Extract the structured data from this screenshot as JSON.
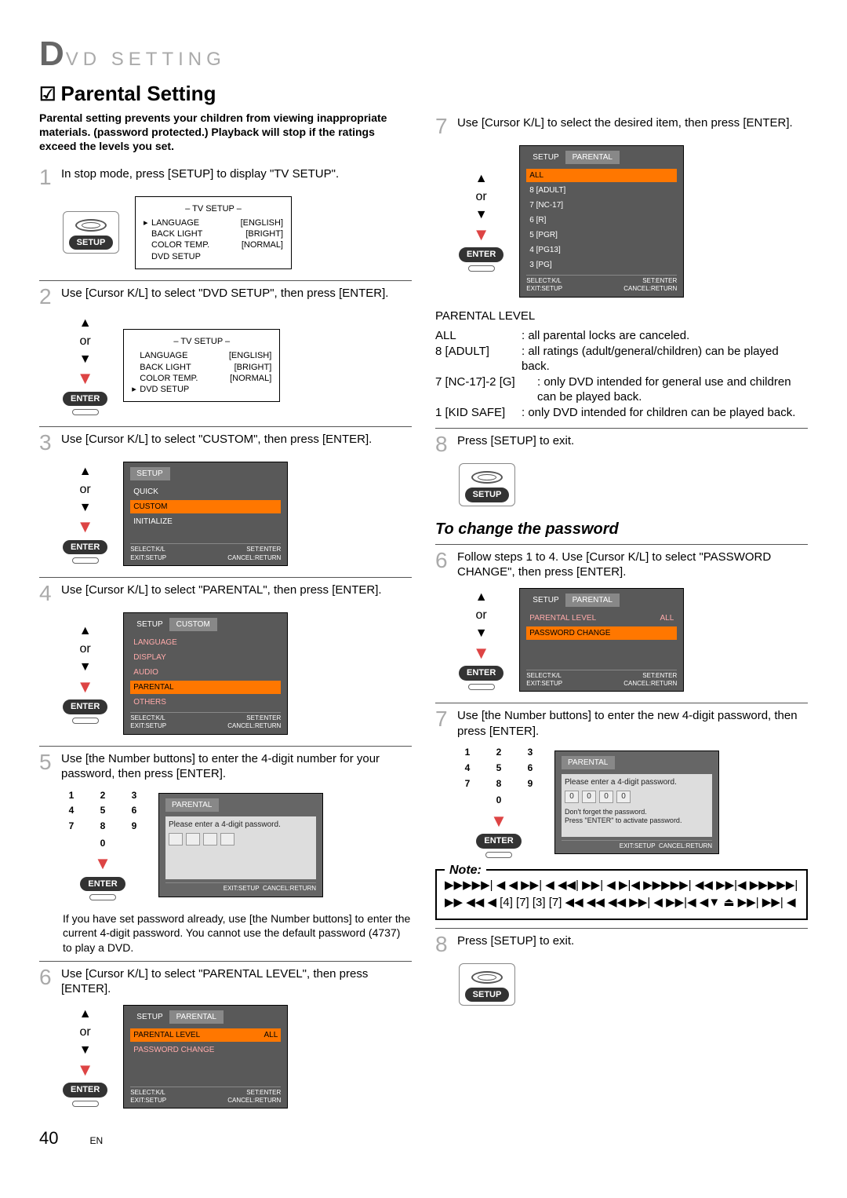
{
  "header": {
    "bigletter": "D",
    "rest": "VD   SETTING"
  },
  "section": {
    "checkmark": "☑",
    "title": "Parental Setting"
  },
  "intro": "Parental setting prevents your children from viewing inappropriate materials. (password protected.) Playback will stop if the ratings exceed the levels you set.",
  "or_label": "or",
  "setup_label": "SETUP",
  "enter_label": "ENTER",
  "step1": {
    "num": "1",
    "text": "In stop mode, press [SETUP] to display \"TV SETUP\"."
  },
  "tv_setup_title": "–  TV SETUP  –",
  "tv_rows": {
    "lang_l": "LANGUAGE",
    "lang_r": "[ENGLISH]",
    "back_l": "BACK LIGHT",
    "back_r": "[BRIGHT]",
    "color_l": "COLOR TEMP.",
    "color_r": "[NORMAL]",
    "dvd": "DVD SETUP"
  },
  "step2": {
    "num": "2",
    "text": "Use [Cursor K/L] to select \"DVD SETUP\", then press [ENTER]."
  },
  "step3": {
    "num": "3",
    "text": "Use [Cursor K/L] to select \"CUSTOM\", then press [ENTER]."
  },
  "setup_tab": "SETUP",
  "custom_tab": "CUSTOM",
  "parental_tab": "PARENTAL",
  "menu3": {
    "r1": "QUICK",
    "r2": "CUSTOM",
    "r3": "INITIALIZE"
  },
  "footer_left1": "SELECT:K/L",
  "footer_left2": "EXIT:SETUP",
  "footer_right1": "SET:ENTER",
  "footer_right2": "CANCEL:RETURN",
  "step4": {
    "num": "4",
    "text": "Use [Cursor K/L] to select \"PARENTAL\", then press [ENTER]."
  },
  "menu4": {
    "r1": "LANGUAGE",
    "r2": "DISPLAY",
    "r3": "AUDIO",
    "r4": "PARENTAL",
    "r5": "OTHERS"
  },
  "step5": {
    "num": "5",
    "text": "Use [the Number buttons] to enter the 4-digit number for your password, then press [ENTER]."
  },
  "numpad": {
    "n1": "1",
    "n2": "2",
    "n3": "3",
    "n4": "4",
    "n5": "5",
    "n6": "6",
    "n7": "7",
    "n8": "8",
    "n9": "9",
    "n0": "0"
  },
  "pw_prompt": "Please enter a 4-digit password.",
  "step5_note": "If you have set password already, use [the Number buttons] to enter the current 4-digit password. You cannot use the default password (4737) to play a DVD.",
  "step6": {
    "num": "6",
    "text": "Use [Cursor K/L] to select \"PARENTAL LEVEL\", then press [ENTER]."
  },
  "menu6": {
    "r1": "PARENTAL LEVEL",
    "r1v": "ALL",
    "r2": "PASSWORD CHANGE"
  },
  "step7": {
    "num": "7",
    "text": "Use [Cursor K/L] to select the desired item, then press [ENTER]."
  },
  "menu7": {
    "r0": "ALL",
    "r1": "8 [ADULT]",
    "r2": "7 [NC-17]",
    "r3": "6 [R]",
    "r4": "5 [PGR]",
    "r5": "4 [PG13]",
    "r6": "3 [PG]"
  },
  "level_heading": "PARENTAL LEVEL",
  "levels": {
    "all_k": "ALL",
    "all_v": ": all parental locks are canceled.",
    "adult_k": "8 [ADULT]",
    "adult_v": ": all ratings (adult/general/children) can be played back.",
    "nc_k": "7 [NC-17]-2 [G]",
    "nc_v": ": only DVD intended for general use and children can be played back.",
    "kid_k": "1 [KID SAFE]",
    "kid_v": ": only DVD intended for children can be played back."
  },
  "step8": {
    "num": "8",
    "text": "Press [SETUP] to exit."
  },
  "change_pw_heading": "To change the password",
  "cp_step6": {
    "num": "6",
    "text": "Follow steps 1 to 4. Use [Cursor K/L] to select \"PASSWORD CHANGE\", then press [ENTER]."
  },
  "menu_cp6": {
    "r1": "PARENTAL LEVEL",
    "r1v": "ALL",
    "r2": "PASSWORD CHANGE"
  },
  "cp_step7": {
    "num": "7",
    "text": "Use [the Number buttons] to enter the new 4-digit password, then press [ENTER]."
  },
  "pw_zeros": "0",
  "pw_note1": "Don't forget the password.",
  "pw_note2": "Press \"ENTER\" to activate password.",
  "note_title": "Note:",
  "note_body": "▶▶▶▶▶| ◀ ◀ ▶▶| ◀ ◀◀| ▶▶| ◀ ▶|◀ ▶▶▶▶▶| ◀◀ ▶▶|◀ ▶▶▶▶▶| ▶▶ ◀◀ ◀ [4] [7] [3] [7] ◀◀ ◀◀ ◀◀ ▶▶| ◀ ▶▶|◀ ◀▼ ⏏ ▶▶| ▶▶| ◀",
  "cp_step8": {
    "num": "8",
    "text": "Press [SETUP] to exit."
  },
  "page_number": "40",
  "lang_code": "EN"
}
